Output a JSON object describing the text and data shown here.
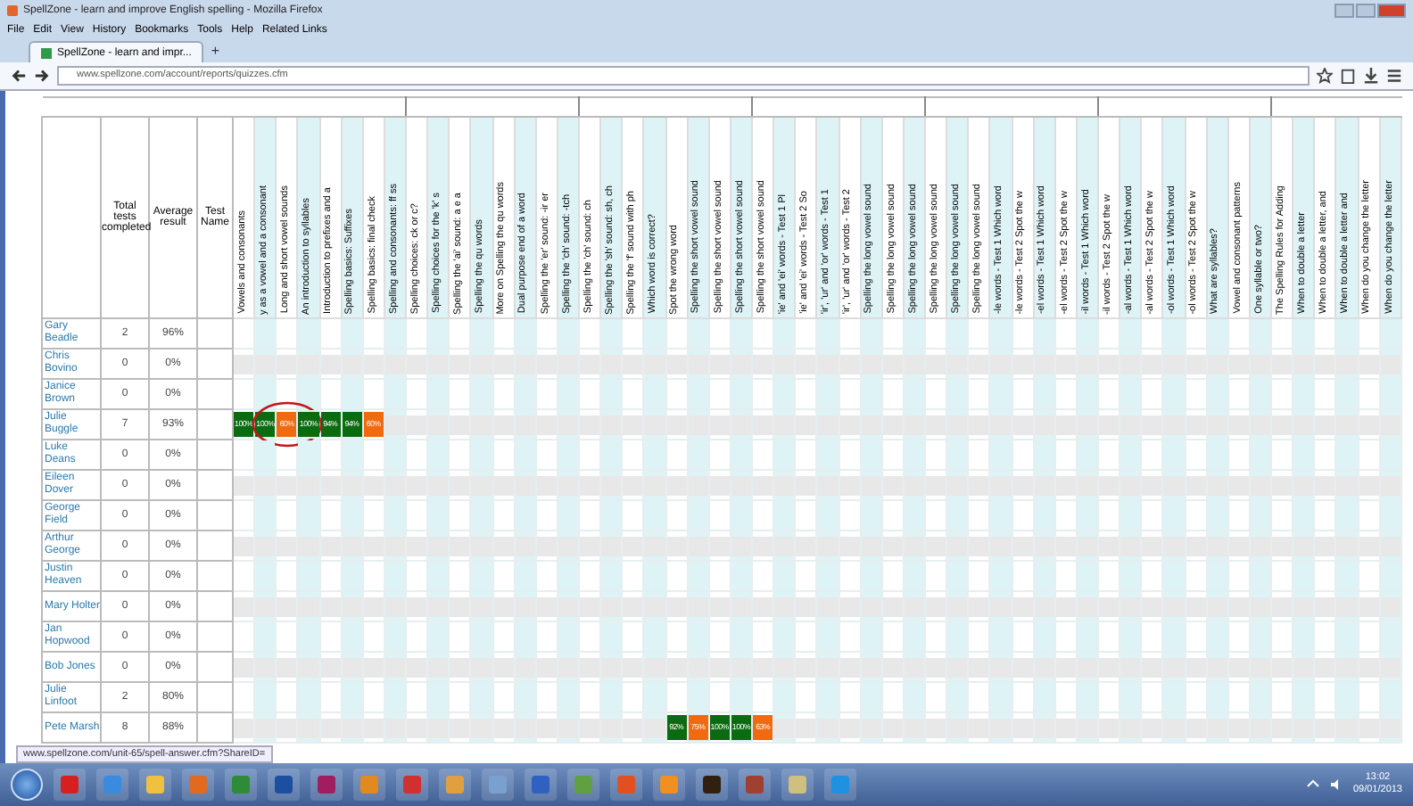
{
  "window": {
    "title": "SpellZone - learn and improve English spelling - Mozilla Firefox"
  },
  "menu": [
    "File",
    "Edit",
    "View",
    "History",
    "Bookmarks",
    "Tools",
    "Help",
    "Related Links"
  ],
  "tabs": [
    {
      "label": "SpellZone - learn and impr...",
      "selected": true
    }
  ],
  "new_tab": "+",
  "address": "www.spellzone.com/account/reports/quizzes.cfm",
  "table": {
    "columns": [
      "Total tests completed",
      "Average result",
      "Test Name"
    ],
    "tests": [
      {
        "label": "Vowels and consonants"
      },
      {
        "label": "y as a vowel and a consonant"
      },
      {
        "label": "Long and short vowel sounds"
      },
      {
        "label": "An introduction to syllables"
      },
      {
        "label": "Introduction to prefixes and a"
      },
      {
        "label": "Spelling basics: Suffixes"
      },
      {
        "label": "Spelling basics: final check"
      },
      {
        "label": "Spelling and consonants: ff ss"
      },
      {
        "label": "Spelling choices: ck or c?"
      },
      {
        "label": "Spelling choices for the 'k' s"
      },
      {
        "label": "Spelling the 'ai' sound: a e a"
      },
      {
        "label": "Spelling the qu words"
      },
      {
        "label": "More on Spelling the qu words"
      },
      {
        "label": "Dual purpose end of a word"
      },
      {
        "label": "Spelling the 'er' sound: -ir er"
      },
      {
        "label": "Spelling the 'ch' sound: -tch"
      },
      {
        "label": "Spelling the 'ch' sound: ch"
      },
      {
        "label": "Spelling the 'sh' sound: sh, ch"
      },
      {
        "label": "Spelling the 'f' sound with ph"
      },
      {
        "label": "Which word is correct?"
      },
      {
        "label": "Spot the wrong word"
      },
      {
        "label": "Spelling the short vowel sound"
      },
      {
        "label": "Spelling the short vowel sound"
      },
      {
        "label": "Spelling the short vowel sound"
      },
      {
        "label": "Spelling the short vowel sound"
      },
      {
        "label": "'ie' and 'ei' words - Test 1 Pl"
      },
      {
        "label": "'ie' and 'ei' words - Test 2 So"
      },
      {
        "label": "'ir', 'ur' and 'or' words - Test 1"
      },
      {
        "label": "'ir', 'ur' and 'or' words - Test 2"
      },
      {
        "label": "Spelling the long vowel sound"
      },
      {
        "label": "Spelling the long vowel sound"
      },
      {
        "label": "Spelling the long vowel sound"
      },
      {
        "label": "Spelling the long vowel sound"
      },
      {
        "label": "Spelling the long vowel sound"
      },
      {
        "label": "Spelling the long vowel sound"
      },
      {
        "label": "-le words - Test 1 Which word"
      },
      {
        "label": "-le words - Test 2 Spot the w"
      },
      {
        "label": "-el words - Test 1 Which word"
      },
      {
        "label": "-el words - Test 2 Spot the w"
      },
      {
        "label": "-il words - Test 1 Which word"
      },
      {
        "label": "-il words - Test 2 Spot the w"
      },
      {
        "label": "-al words - Test 1 Which word"
      },
      {
        "label": "-al words - Test 2 Spot the w"
      },
      {
        "label": "-ol words - Test 1 Which word"
      },
      {
        "label": "-ol words - Test 2 Spot the w"
      },
      {
        "label": "What are syllables?"
      },
      {
        "label": "Vowel and consonant patterns"
      },
      {
        "label": "One syllable or two?"
      },
      {
        "label": "The Spelling Rules for Adding"
      },
      {
        "label": "When to double a letter"
      },
      {
        "label": "When to double a letter, and"
      },
      {
        "label": "When to double a letter and"
      },
      {
        "label": "When do you change the letter"
      },
      {
        "label": "When do you change the letter"
      }
    ],
    "rows": [
      {
        "name": "Gary Beadle",
        "total": "2",
        "average": "96%"
      },
      {
        "name": "Chris Bovino",
        "total": "0",
        "average": "0%"
      },
      {
        "name": "Janice Brown",
        "total": "0",
        "average": "0%"
      },
      {
        "name": "Julie Buggle",
        "total": "7",
        "average": "93%",
        "scores": [
          {
            "kind": "result",
            "text": "100%",
            "color": "#0b6b10",
            "circled": false
          },
          {
            "kind": "result",
            "text": "100%",
            "color": "#0b6b10",
            "circled": false
          },
          {
            "kind": "result",
            "text": "60%",
            "color": "#f26a10",
            "circled": true
          },
          {
            "kind": "result",
            "text": "100%",
            "color": "#0b6b10",
            "circled": false
          },
          {
            "kind": "result",
            "text": "94%",
            "color": "#0b6b10",
            "circled": false
          },
          {
            "kind": "result",
            "text": "94%",
            "color": "#0b6b10",
            "circled": false
          },
          {
            "kind": "result",
            "text": "60%",
            "color": "#f26a10",
            "circled": false
          }
        ]
      },
      {
        "name": "Luke Deans",
        "total": "0",
        "average": "0%"
      },
      {
        "name": "Eileen Dover",
        "total": "0",
        "average": "0%"
      },
      {
        "name": "George Field",
        "total": "0",
        "average": "0%"
      },
      {
        "name": "Arthur George",
        "total": "0",
        "average": "0%"
      },
      {
        "name": "Justin Heaven",
        "total": "0",
        "average": "0%"
      },
      {
        "name": "Mary Holter",
        "total": "0",
        "average": "0%"
      },
      {
        "name": "Jan Hopwood",
        "total": "0",
        "average": "0%"
      },
      {
        "name": "Bob Jones",
        "total": "0",
        "average": "0%"
      },
      {
        "name": "Julie Linfoot",
        "total": "2",
        "average": "80%"
      },
      {
        "name": "Pete Marsh",
        "total": "8",
        "average": "88%",
        "scores": [
          {
            "kind": "empty"
          },
          {
            "kind": "empty"
          },
          {
            "kind": "empty"
          },
          {
            "kind": "empty"
          },
          {
            "kind": "empty"
          },
          {
            "kind": "empty"
          },
          {
            "kind": "empty"
          },
          {
            "kind": "empty"
          },
          {
            "kind": "empty"
          },
          {
            "kind": "empty"
          },
          {
            "kind": "empty"
          },
          {
            "kind": "empty"
          },
          {
            "kind": "empty"
          },
          {
            "kind": "empty"
          },
          {
            "kind": "empty"
          },
          {
            "kind": "empty"
          },
          {
            "kind": "empty"
          },
          {
            "kind": "empty"
          },
          {
            "kind": "empty"
          },
          {
            "kind": "empty"
          },
          {
            "kind": "result",
            "text": "92%",
            "color": "#0b6b10",
            "circled": false
          },
          {
            "kind": "result",
            "text": "75%",
            "color": "#f26a10",
            "circled": false
          },
          {
            "kind": "result",
            "text": "100%",
            "color": "#0b6b10",
            "circled": false
          },
          {
            "kind": "result",
            "text": "100%",
            "color": "#0b6b10",
            "circled": false
          },
          {
            "kind": "result",
            "text": "63%",
            "color": "#f26a10",
            "circled": false
          }
        ]
      }
    ]
  },
  "status_bar": "www.spellzone.com/unit-65/spell-answer.cfm?ShareID=",
  "clock": {
    "time": "13:02",
    "date": "09/01/2013"
  }
}
